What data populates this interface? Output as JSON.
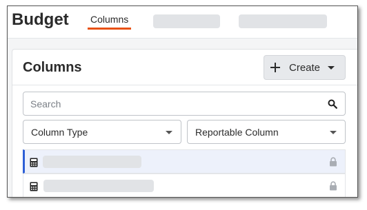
{
  "header": {
    "app_title": "Budget",
    "active_tab": "Columns"
  },
  "panel": {
    "title": "Columns",
    "create_button": {
      "label": "Create",
      "icon": "plus-icon"
    }
  },
  "search": {
    "placeholder": "Search",
    "value": "",
    "icon": "search-icon"
  },
  "filters": {
    "column_type": "Column Type",
    "reportable_column": "Reportable Column"
  },
  "rows": [
    {
      "icon": "calculator-icon",
      "locked": true,
      "selected": true
    },
    {
      "icon": "calculator-icon",
      "locked": true,
      "selected": false
    }
  ],
  "colors": {
    "accent_tab": "#e8500e",
    "selection": "#2d5fd6",
    "selection_bg": "#edf1fb"
  }
}
